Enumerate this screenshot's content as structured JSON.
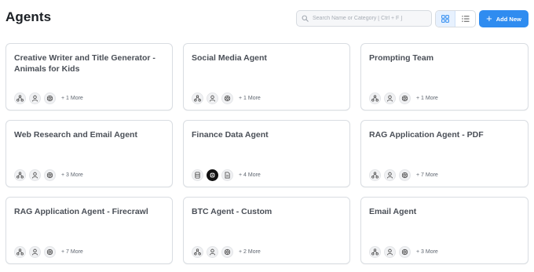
{
  "header": {
    "title": "Agents",
    "search_placeholder": "Search Name or Category [ Ctrl + F ]",
    "add_label": "Add New"
  },
  "colors": {
    "accent": "#2f8cf0"
  },
  "cards": [
    {
      "title": "Creative Writer and Title Generator - Animals for Kids",
      "icons": [
        "network-icon",
        "user-icon",
        "openai-icon"
      ],
      "more": "+ 1 More"
    },
    {
      "title": "Social Media Agent",
      "icons": [
        "network-icon",
        "user-icon",
        "openai-icon"
      ],
      "more": "+ 1 More"
    },
    {
      "title": "Prompting Team",
      "icons": [
        "network-icon",
        "user-icon",
        "openai-icon"
      ],
      "more": "+ 1 More"
    },
    {
      "title": "Web Research and Email Agent",
      "icons": [
        "network-icon",
        "user-icon",
        "openai-icon"
      ],
      "more": "+ 3 More"
    },
    {
      "title": "Finance Data Agent",
      "icons": [
        "database-icon",
        "app-logo-icon",
        "document-icon"
      ],
      "more": "+ 4 More"
    },
    {
      "title": "RAG Application Agent - PDF",
      "icons": [
        "network-icon",
        "user-icon",
        "openai-icon"
      ],
      "more": "+ 7 More"
    },
    {
      "title": "RAG Application Agent - Firecrawl",
      "icons": [
        "network-icon",
        "user-icon",
        "openai-icon"
      ],
      "more": "+ 7 More"
    },
    {
      "title": "BTC Agent - Custom",
      "icons": [
        "network-icon",
        "user-icon",
        "openai-icon"
      ],
      "more": "+ 2 More"
    },
    {
      "title": "Email Agent",
      "icons": [
        "network-icon",
        "user-icon",
        "openai-icon"
      ],
      "more": "+ 3 More"
    }
  ]
}
